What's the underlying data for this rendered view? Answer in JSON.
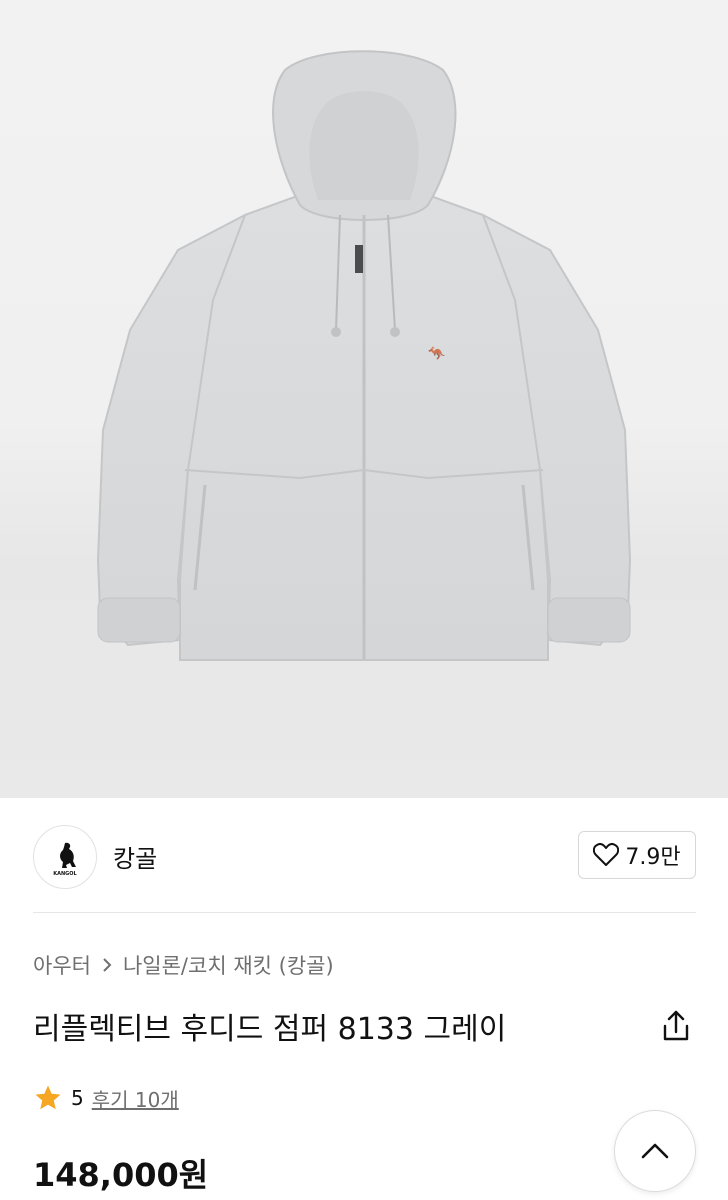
{
  "product_image": {
    "alt": "jacket-photo"
  },
  "brand": {
    "name": "캉골",
    "logo_text": "KANGOL"
  },
  "like": {
    "count": "7.9만"
  },
  "breadcrumb": {
    "items": [
      "아우터",
      "나일론/코치 재킷 (캉골)"
    ]
  },
  "product": {
    "title": "리플렉티브 후디드 점퍼 8133 그레이",
    "price": "148,000원"
  },
  "rating": {
    "score": "5",
    "reviews": "후기 10개"
  },
  "colors": {
    "star": "#f5a623",
    "text": "#111111",
    "muted": "#6f6f6f",
    "jacket": "#d9dbdd"
  }
}
